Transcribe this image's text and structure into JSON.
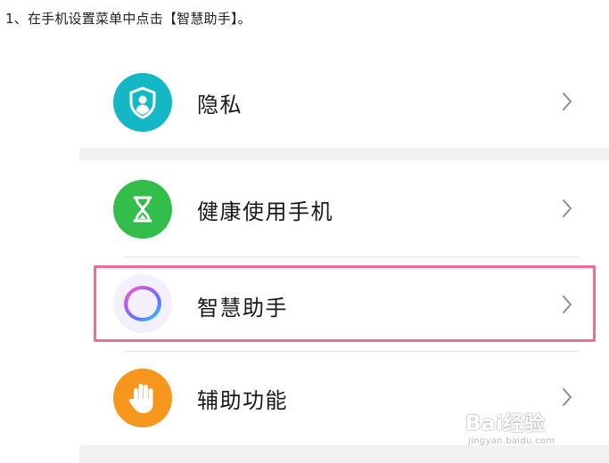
{
  "instruction": "1、在手机设置菜单中点击【智慧助手】。",
  "settings": {
    "items": [
      {
        "label": "隐私",
        "icon": "shield-user-icon",
        "icon_color": "#14b8c4"
      },
      {
        "label": "健康使用手机",
        "icon": "hourglass-icon",
        "icon_color": "#33bd4a"
      },
      {
        "label": "智慧助手",
        "icon": "smart-assistant-ring-icon",
        "icon_color": "#8a5cf6"
      },
      {
        "label": "辅助功能",
        "icon": "hand-icon",
        "icon_color": "#f7961c"
      }
    ],
    "highlighted_item": "智慧助手",
    "highlight_color": "#ec6d97"
  },
  "watermark": {
    "main": "Bai经验",
    "sub": "jingyan.baidu.com"
  }
}
